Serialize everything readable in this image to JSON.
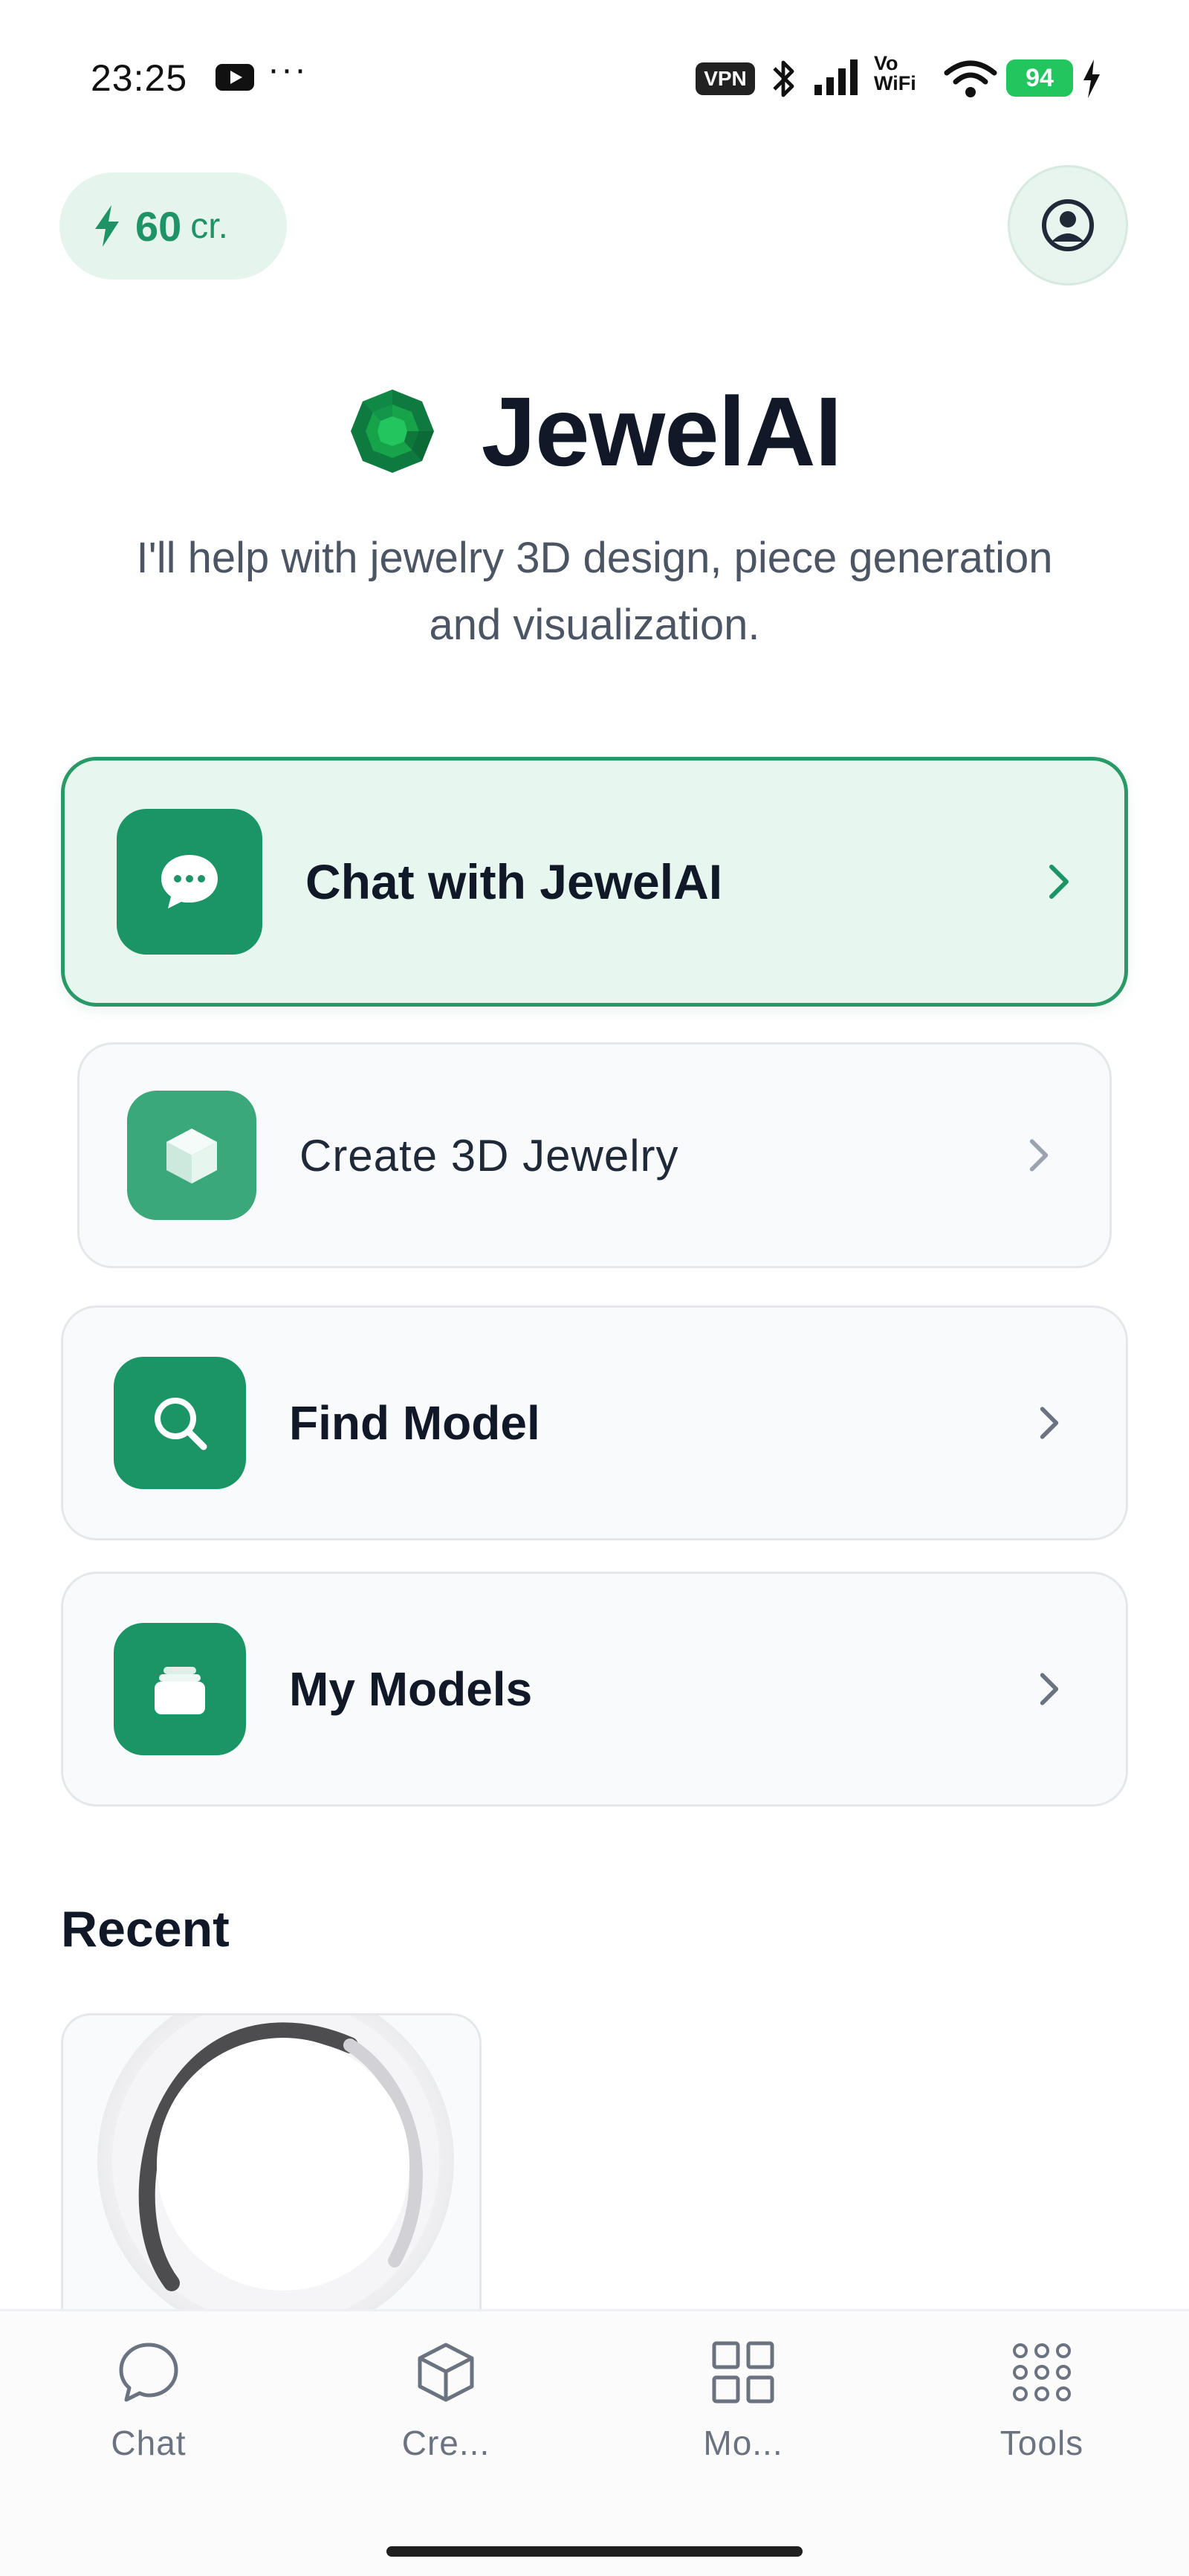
{
  "status_bar": {
    "time": "23:25",
    "more": "···",
    "vpn": "VPN",
    "vowifi_top": "Vo",
    "vowifi_bottom": "WiFi",
    "battery": "94"
  },
  "header": {
    "credits_amount": "60",
    "credits_unit": "cr.",
    "profile_icon": "user-circle-icon"
  },
  "hero": {
    "title": "JewelAI",
    "subtitle": "I'll help with jewelry 3D design, piece generation and visualization."
  },
  "actions": [
    {
      "label": "Chat with JewelAI",
      "icon": "chat-dots-icon"
    },
    {
      "label": "Create 3D Jewelry",
      "icon": "cube-icon"
    },
    {
      "label": "Find Model",
      "icon": "search-icon"
    },
    {
      "label": "My Models",
      "icon": "stack-icon"
    }
  ],
  "recent": {
    "title": "Recent"
  },
  "bottom_nav": [
    {
      "label": "Chat",
      "icon": "chat-bubble-icon"
    },
    {
      "label": "Cre...",
      "icon": "cube-icon"
    },
    {
      "label": "Mo...",
      "icon": "grid-icon"
    },
    {
      "label": "Tools",
      "icon": "dots-grid-icon"
    }
  ],
  "colors": {
    "brand_green": "#1b9466",
    "accent_light": "#e7f6ee",
    "battery_green": "#22c55e"
  }
}
